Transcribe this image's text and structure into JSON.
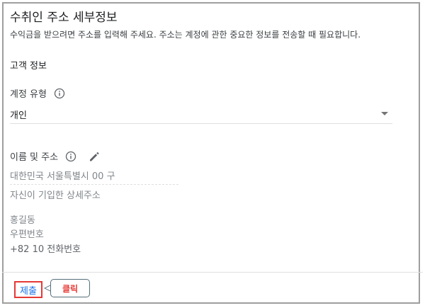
{
  "form": {
    "title": "수취인 주소 세부정보",
    "description": "수익금을 받으려면 주소를 입력해 주세요. 주소는 계정에 관한 중요한 정보를 전송할 때 필요합니다.",
    "section_title": "고객 정보",
    "account_type": {
      "label": "계정 유형",
      "value": "개인"
    },
    "name_address": {
      "label": "이름 및 주소",
      "lines": [
        "대한민국 서울특별시 00  구",
        "자신이 기입한 상세주소",
        "홍길동",
        "우편번호",
        "+82  10 전화번호"
      ]
    },
    "submit_label": "제출"
  },
  "annotation": {
    "callout_label": "클릭",
    "callout_color": "#e53935"
  },
  "colors": {
    "link_blue": "#1a73e8",
    "highlight_red": "#e53935"
  },
  "icons": {
    "info": "info-icon",
    "edit": "pencil-icon",
    "dropdown": "caret-down-icon"
  }
}
